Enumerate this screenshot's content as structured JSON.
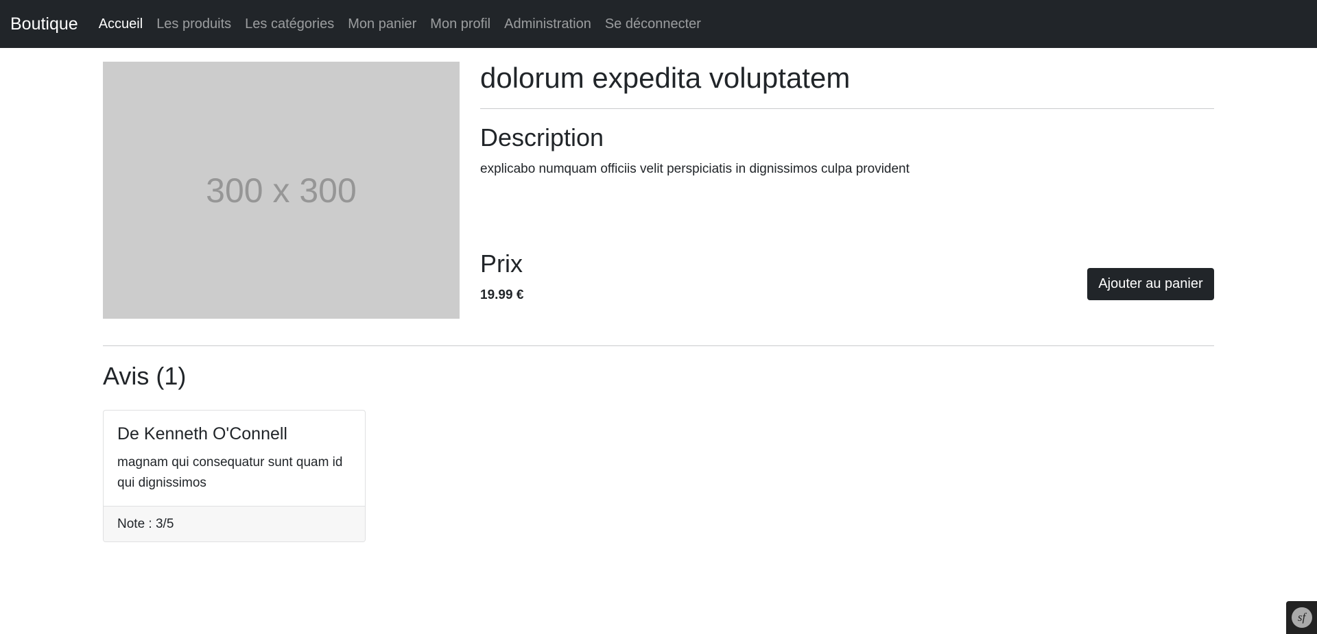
{
  "navbar": {
    "brand": "Boutique",
    "links": [
      {
        "label": "Accueil",
        "active": true
      },
      {
        "label": "Les produits",
        "active": false
      },
      {
        "label": "Les catégories",
        "active": false
      },
      {
        "label": "Mon panier",
        "active": false
      },
      {
        "label": "Mon profil",
        "active": false
      },
      {
        "label": "Administration",
        "active": false
      },
      {
        "label": "Se déconnecter",
        "active": false
      }
    ]
  },
  "product": {
    "image_placeholder": "300 x 300",
    "title": "dolorum expedita voluptatem",
    "description_heading": "Description",
    "description": "explicabo numquam officiis velit perspiciatis in dignissimos culpa provident",
    "price_heading": "Prix",
    "price": "19.99 €",
    "add_to_cart_label": "Ajouter au panier"
  },
  "reviews": {
    "heading": "Avis (1)",
    "items": [
      {
        "author": "De Kenneth O'Connell",
        "text": "magnam qui consequatur sunt quam id qui dignissimos",
        "rating": "Note : 3/5"
      }
    ]
  },
  "debug_toolbar": {
    "logo": "sf"
  },
  "colors": {
    "navbar_bg": "#212529",
    "placeholder_bg": "#cccccc",
    "button_bg": "#212529"
  }
}
